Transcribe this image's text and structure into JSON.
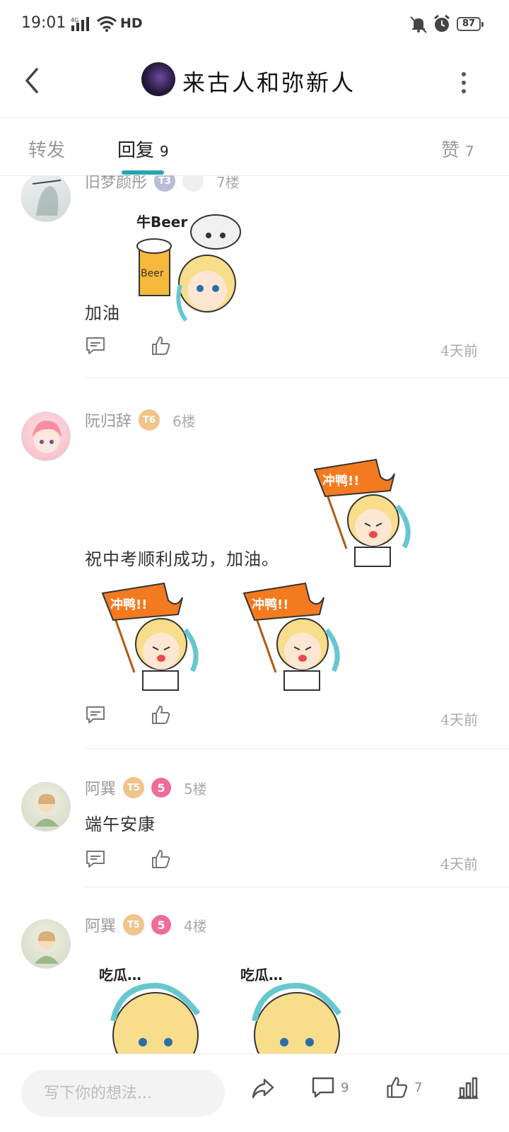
{
  "status_bar": {
    "time": "19:01",
    "network": "4G",
    "hd": "HD",
    "battery": "87"
  },
  "header": {
    "title": "来古人和弥新人"
  },
  "tabs": {
    "repost": "转发",
    "reply": "回复",
    "reply_count": "9",
    "like": "赞",
    "like_count": "7"
  },
  "posts": [
    {
      "username": "旧梦颜彤",
      "level": "T3",
      "floor": "7楼",
      "text": "加油",
      "time": "4天前",
      "sticker_text": "牛Beer",
      "sticker_mug": "Beer"
    },
    {
      "username": "阮归辞",
      "level": "T6",
      "floor": "6楼",
      "text": "祝中考顺利成功，加油。",
      "time": "4天前",
      "sticker_text": "冲鸭!!"
    },
    {
      "username": "阿巽",
      "level": "T5",
      "medal": "5",
      "floor": "5楼",
      "text": "端午安康",
      "time": "4天前"
    },
    {
      "username": "阿巽",
      "level": "T5",
      "medal": "5",
      "floor": "4楼",
      "sticker_text": "吃瓜…"
    }
  ],
  "bottom_bar": {
    "placeholder": "写下你的想法...",
    "comment_count": "9",
    "like_count": "7"
  },
  "colors": {
    "accent": "#25a6b3",
    "muted_text": "#999999",
    "divider": "#ececec"
  }
}
